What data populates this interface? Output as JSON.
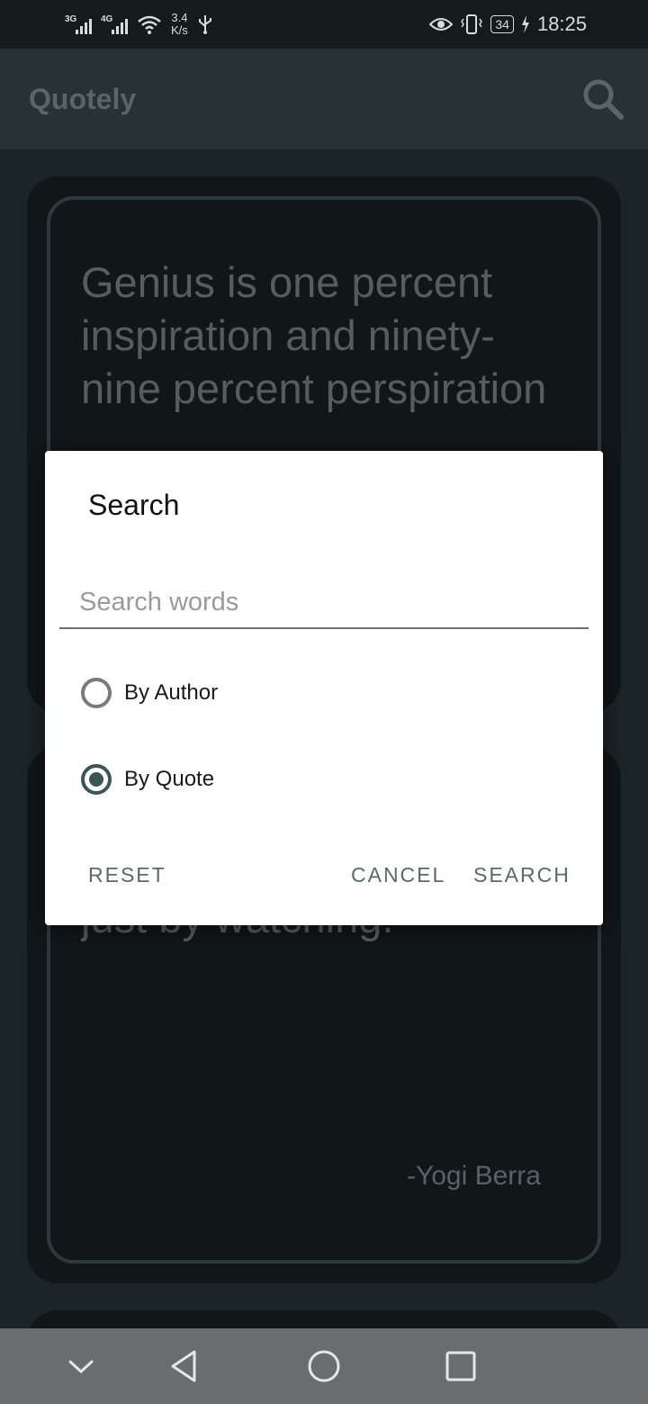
{
  "status_bar": {
    "signal_1_label": "3G",
    "signal_2_label": "4G",
    "speed_value": "3.4",
    "speed_unit": "K/s",
    "battery": "34",
    "time": "18:25",
    "icons": [
      "signal-icon",
      "wifi-icon",
      "usb-icon",
      "eye-icon",
      "vibrate-icon",
      "battery-icon",
      "charging-icon"
    ]
  },
  "app_bar": {
    "title": "Quotely",
    "search_icon": "search-icon"
  },
  "cards": [
    {
      "quote": "Genius is one percent inspiration and ninety-nine percent perspiration",
      "author": ""
    },
    {
      "quote": "just by watching.",
      "author": "-Yogi Berra"
    }
  ],
  "dialog": {
    "title": "Search",
    "input_placeholder": "Search words",
    "input_value": "",
    "options": [
      {
        "label": "By Author",
        "selected": false
      },
      {
        "label": "By Quote",
        "selected": true
      }
    ],
    "buttons": {
      "reset": "RESET",
      "cancel": "CANCEL",
      "search": "SEARCH"
    }
  },
  "nav_bar": {
    "icons": [
      "chevron-down-icon",
      "back-icon",
      "home-icon",
      "recents-icon"
    ]
  },
  "colors": {
    "accent": "#3d5557",
    "app_bar": "#283133",
    "background": "#1b2426",
    "card": "#111618"
  }
}
